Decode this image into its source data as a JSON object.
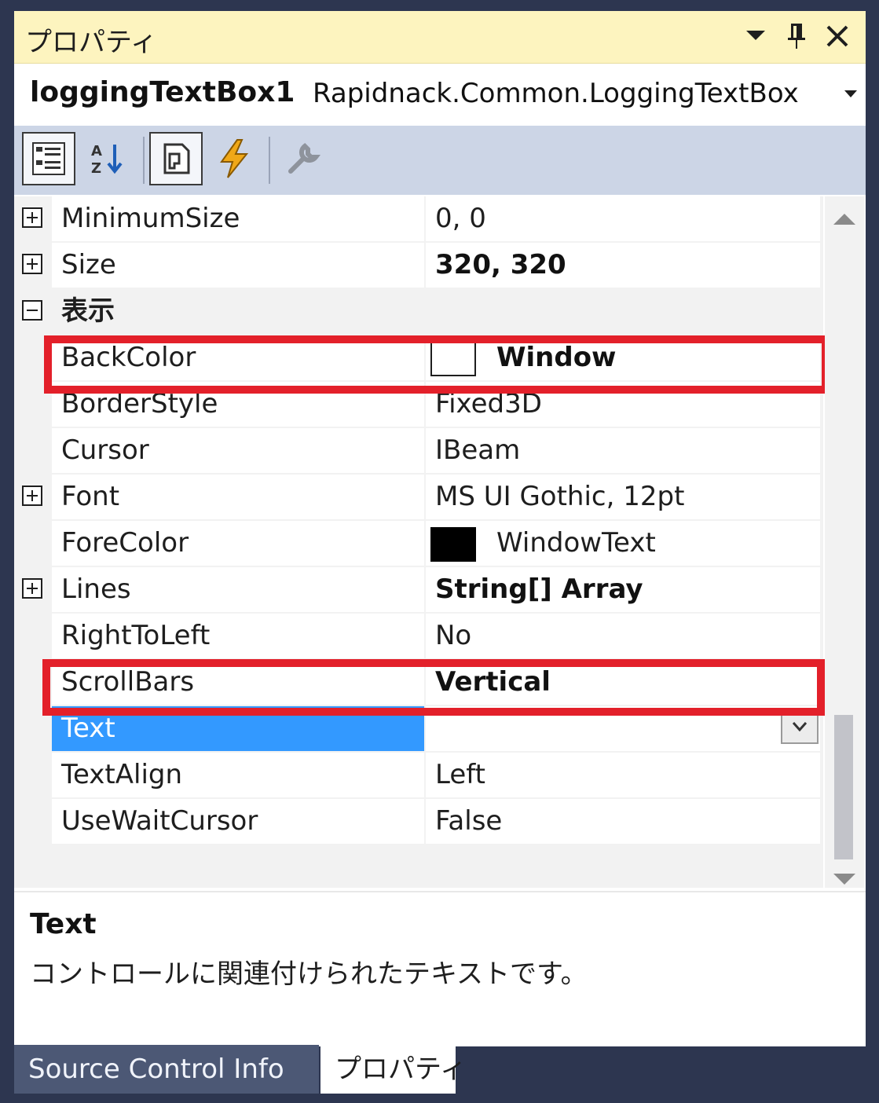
{
  "panel": {
    "title": "プロパティ",
    "object_name": "loggingTextBox1",
    "object_type": "Rapidnack.Common.LoggingTextBox"
  },
  "toolbar": {
    "icons": [
      "categorized-icon",
      "alphabetical-icon",
      "properties-icon",
      "events-icon",
      "property-pages-icon"
    ]
  },
  "properties": [
    {
      "name": "MinimumSize",
      "value": "0, 0"
    },
    {
      "name": "Size",
      "value": "320, 320"
    },
    {
      "category": "表示"
    },
    {
      "name": "BackColor",
      "value": "Window",
      "swatch": "#ffffff"
    },
    {
      "name": "BorderStyle",
      "value": "Fixed3D"
    },
    {
      "name": "Cursor",
      "value": "IBeam"
    },
    {
      "name": "Font",
      "value": "MS UI Gothic, 12pt"
    },
    {
      "name": "ForeColor",
      "value": "WindowText",
      "swatch": "#000000"
    },
    {
      "name": "Lines",
      "value": "String[] Array"
    },
    {
      "name": "RightToLeft",
      "value": "No"
    },
    {
      "name": "ScrollBars",
      "value": "Vertical"
    },
    {
      "name": "Text",
      "value": ""
    },
    {
      "name": "TextAlign",
      "value": "Left"
    },
    {
      "name": "UseWaitCursor",
      "value": "False"
    }
  ],
  "description": {
    "title": "Text",
    "text": "コントロールに関連付けられたテキストです。"
  },
  "tabs": [
    {
      "label": "Source Control Info",
      "active": false
    },
    {
      "label": "プロパティ",
      "active": true
    }
  ],
  "colors": {
    "title_bar": "#fdf4bf",
    "toolbar": "#ccd5e6",
    "selection": "#3399ff",
    "highlight_box": "#e3202a",
    "frame": "#2d3650"
  }
}
